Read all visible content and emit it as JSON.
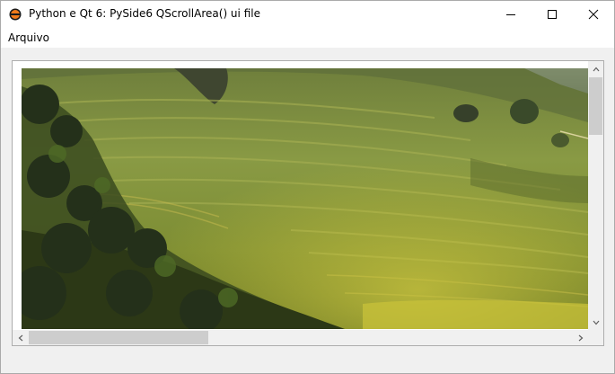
{
  "window": {
    "title": "Python e Qt 6: PySide6 QScrollArea() ui file",
    "icon": "qt-python-app-icon",
    "controls": [
      "minimize-icon",
      "maximize-icon",
      "close-icon"
    ]
  },
  "menubar": {
    "items": [
      {
        "label": "Arquivo"
      }
    ]
  },
  "scroll_area": {
    "content": "rice-terraces-photo",
    "vertical_scroll_fraction": 0.0,
    "horizontal_scroll_fraction": 0.0
  }
}
